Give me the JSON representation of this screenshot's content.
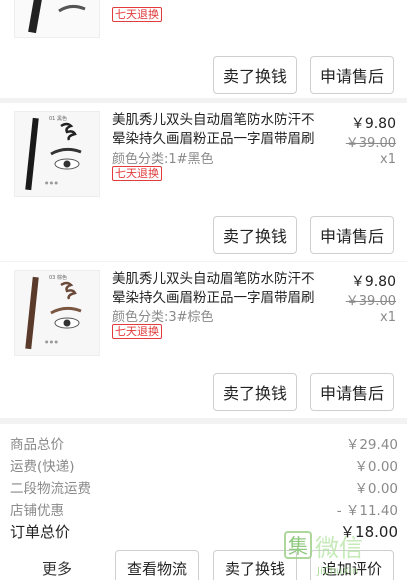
{
  "items": [
    {
      "tag": "七天退换",
      "buttons": {
        "sell": "卖了换钱",
        "after_sale": "申请售后"
      }
    },
    {
      "title": "美肌秀儿双头自动眉笔防水防汗不晕染持久画眉粉正品一字眉带眉刷",
      "variant": "颜色分类:1#黑色",
      "tag": "七天退换",
      "price": "￥9.80",
      "original_price": "￥39.00",
      "quantity": "x1",
      "thumb_label": "01 黑色",
      "buttons": {
        "sell": "卖了换钱",
        "after_sale": "申请售后"
      }
    },
    {
      "title": "美肌秀儿双头自动眉笔防水防汗不晕染持久画眉粉正品一字眉带眉刷",
      "variant": "颜色分类:3#棕色",
      "tag": "七天退换",
      "price": "￥9.80",
      "original_price": "￥39.00",
      "quantity": "x1",
      "thumb_label": "03 棕色",
      "buttons": {
        "sell": "卖了换钱",
        "after_sale": "申请售后"
      }
    }
  ],
  "summary": {
    "rows": [
      {
        "label": "商品总价",
        "value": "￥29.40"
      },
      {
        "label": "运费(快递)",
        "value": "￥0.00"
      },
      {
        "label": "二段物流运费",
        "value": "￥0.00"
      },
      {
        "label": "店铺优惠",
        "value": "- ￥11.40"
      }
    ],
    "total_label": "订单总价",
    "total_value": "￥18.00"
  },
  "bottom_bar": {
    "more": "更多",
    "logistics": "查看物流",
    "sell": "卖了换钱",
    "review": "追加评价"
  },
  "watermark": {
    "text": "集微信",
    "sub": "JiChuXin"
  },
  "colors": {
    "tag_red": "#e23b3b",
    "text": "#222222",
    "muted": "#8a8a8a",
    "background": "#f2f2f2"
  }
}
